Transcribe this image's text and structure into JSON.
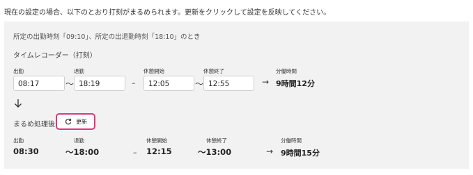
{
  "intro": "現在の設定の場合、以下のとおり打刻がまるめられます。更新をクリックして設定を反映してください。",
  "condition": "所定の出勤時刻「09:10」、所定の出退勤時刻「18:10」のとき",
  "recorder": {
    "title": "タイムレコーダー（打刻）",
    "labels": {
      "in": "出勤",
      "out": "退勤",
      "break_start": "休憩開始",
      "break_end": "休憩終了",
      "work": "分働時間"
    },
    "values": {
      "in": "08:17",
      "out": "18:19",
      "break_start": "12:05",
      "break_end": "12:55"
    },
    "total": "9時間12分"
  },
  "separators": {
    "tilde": "～",
    "dash": "–",
    "arrow": "→"
  },
  "down_arrow_icon": "arrow-down",
  "rounded": {
    "title": "まるめ処理後",
    "update_button": "更新",
    "update_icon": "refresh",
    "labels": {
      "in": "出勤",
      "out": "退勤",
      "break_start": "休憩開始",
      "break_end": "休憩終了",
      "work": "分働時間"
    },
    "values": {
      "in": "08:30",
      "out": "～18:00",
      "break_start": "12:15",
      "break_end": "～13:00"
    },
    "total": "9時間15分"
  },
  "colors": {
    "panel_bg": "#f2f2f2",
    "accent": "#e0357a"
  }
}
